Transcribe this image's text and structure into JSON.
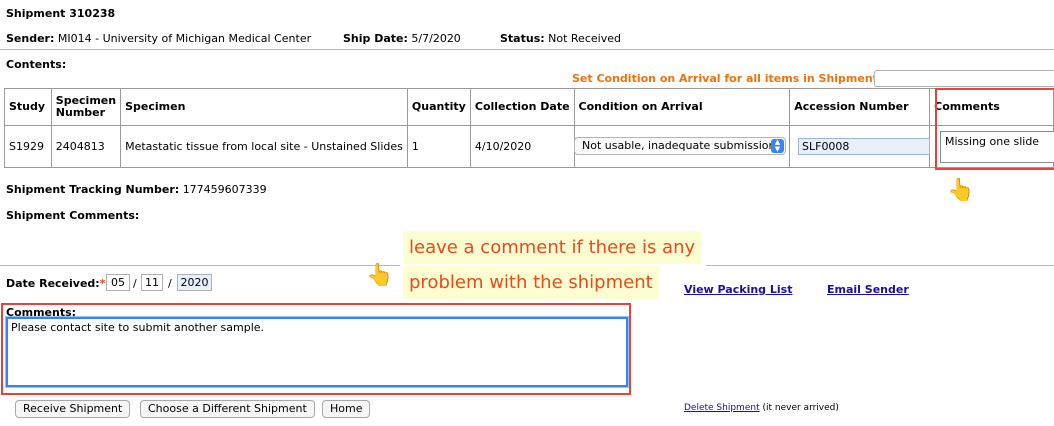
{
  "header": {
    "shipment_title": "Shipment 310238",
    "sender_label": "Sender:",
    "sender_value": "MI014 - University of Michigan Medical Center",
    "ship_date_label": "Ship Date:",
    "ship_date_value": "5/7/2020",
    "status_label": "Status:",
    "status_value": "Not Received"
  },
  "contents_label": "Contents:",
  "set_condition_label": "Set Condition on Arrival for all items in Shipment:",
  "table": {
    "headers": [
      "Study",
      "Specimen Number",
      "Specimen",
      "Quantity",
      "Collection Date",
      "Condition on Arrival",
      "Accession Number",
      "Comments"
    ],
    "rows": [
      {
        "study": "S1929",
        "specimen_number": "2404813",
        "specimen": "Metastatic tissue from local site - Unstained Slides",
        "quantity": "1",
        "collection_date": "4/10/2020",
        "condition": "Not usable, inadequate submission",
        "accession": "SLF0008",
        "comment": "Missing one slide"
      }
    ]
  },
  "tracking_label": "Shipment Tracking Number:",
  "tracking_value": "177459607339",
  "shipment_comments_label": "Shipment Comments:",
  "date_received": {
    "label": "Date Received:",
    "required_mark": "*",
    "month": "05",
    "day": "11",
    "year": "2020",
    "sep": "/"
  },
  "links": {
    "packing_list": "View Packing List",
    "email_sender": "Email Sender",
    "delete_shipment": "Delete Shipment",
    "delete_note": "(it never arrived)"
  },
  "comments_label": "Comments:",
  "comments_value": "Please contact site to submit another sample.",
  "buttons": {
    "receive": "Receive Shipment",
    "choose": "Choose a Different Shipment",
    "home": "Home"
  },
  "callout": {
    "line1": "leave a comment if there is any",
    "line2": "problem with the shipment"
  },
  "icons": {
    "select_chevron": "chevron-updown-icon",
    "pointer": "pointing-hand-icon"
  },
  "colors": {
    "orange_label": "#f0720e",
    "annotation_red": "#e8433a",
    "focus_blue": "#3b82f6",
    "link_blue": "#1a0dab",
    "callout_bg": "#fdfdd2"
  }
}
